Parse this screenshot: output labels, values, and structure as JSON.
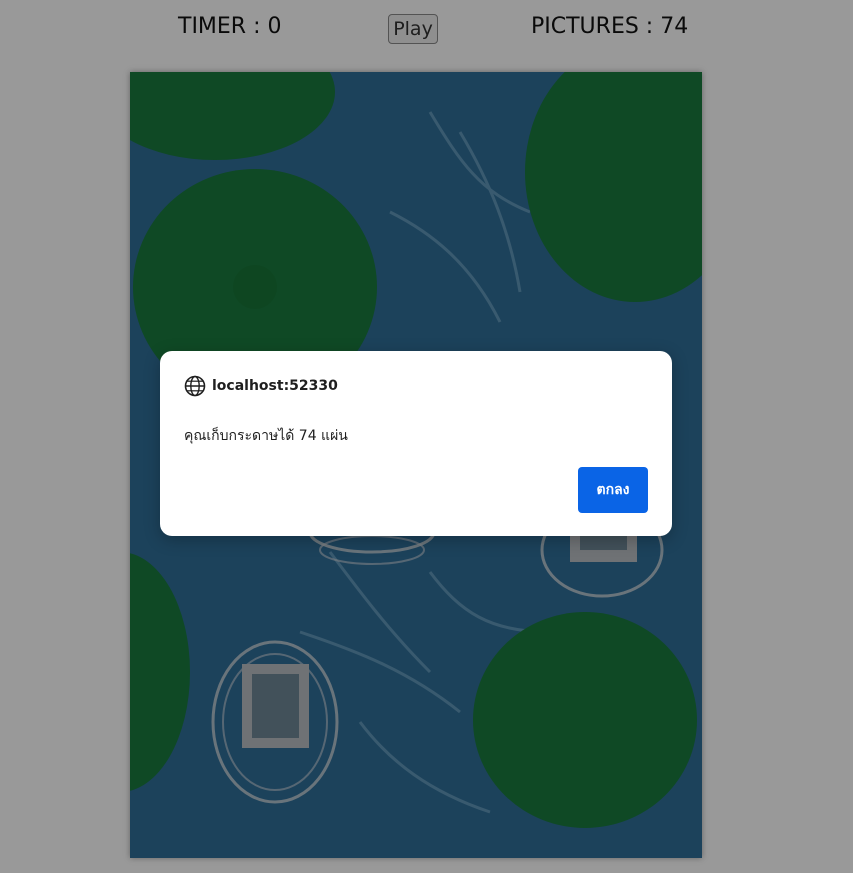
{
  "header": {
    "timer_text": "TIMER : 0",
    "play_label": "Play",
    "pictures_text": "PICTURES : 74"
  },
  "dialog": {
    "origin": "localhost:52330",
    "message": "คุณเก็บกระดาษได้ 74 แผ่น",
    "ok_label": "ตกลง"
  },
  "icons": {
    "dialog_origin_icon": "globe-icon"
  },
  "colors": {
    "water": "#2f6e98",
    "lily_pad": "#1a7a3e",
    "frame": "#b9bec4",
    "ok_button": "#0a64e6",
    "overlay": "rgba(0,0,0,0.4)"
  }
}
